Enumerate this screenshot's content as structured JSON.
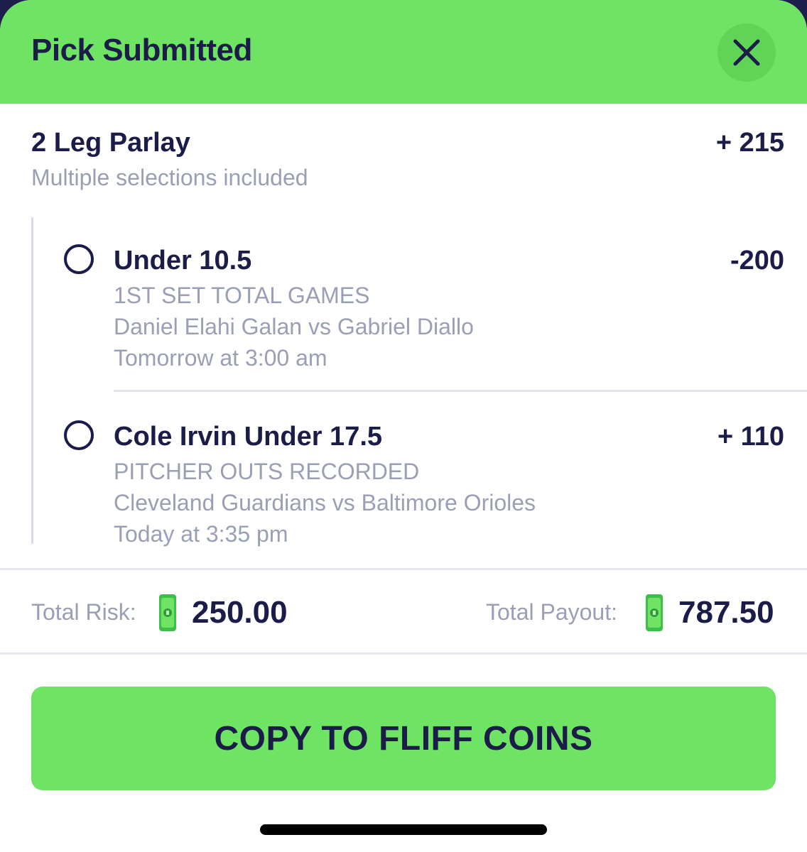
{
  "header": {
    "title": "Pick Submitted"
  },
  "parlay": {
    "title": "2 Leg Parlay",
    "subtitle": "Multiple selections included",
    "odds": "+ 215"
  },
  "legs": [
    {
      "title": "Under 10.5",
      "odds": "-200",
      "market": "1ST SET TOTAL GAMES",
      "matchup": "Daniel Elahi Galan vs Gabriel Diallo",
      "time": "Tomorrow at 3:00 am"
    },
    {
      "title": "Cole Irvin Under 17.5",
      "odds": "+ 110",
      "market": "PITCHER OUTS RECORDED",
      "matchup": "Cleveland Guardians vs Baltimore Orioles",
      "time": "Today at 3:35 pm"
    }
  ],
  "totals": {
    "risk_label": "Total Risk:",
    "risk_value": "250.00",
    "payout_label": "Total Payout:",
    "payout_value": "787.50",
    "currency_icon": "cash-coin-icon"
  },
  "actions": {
    "copy_label": "COPY TO FLIFF COINS"
  },
  "colors": {
    "accent_green": "#6fe464",
    "text_dark": "#1b1d48",
    "text_muted": "#9a9fb3"
  }
}
